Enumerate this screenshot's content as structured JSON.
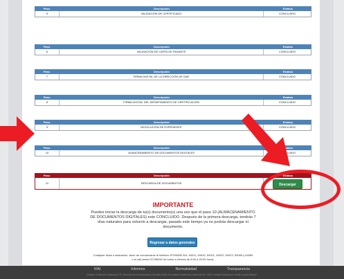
{
  "table_header": {
    "paso": "Paso",
    "descripcion": "Descripción",
    "estatus": "Estatus"
  },
  "steps": [
    {
      "paso": "5",
      "descripcion": "VALIDACIÓN DE CERTIFICADO",
      "estatus": "CONCLUIDO"
    },
    {
      "paso": "6",
      "descripcion": "VALIDACIÓN DE CARTA DE PASANTE",
      "estatus": "CONCLUIDO"
    },
    {
      "paso": "7",
      "descripcion": "FIRMA DIGITAL DE LA DIRECCIÓN DE DAE",
      "estatus": "CONCLUIDO"
    },
    {
      "paso": "8",
      "descripcion": "FIRMA DIGITAL DEL DEPARTAMENTO DE CERTIFICACIÓN",
      "estatus": "CONCLUIDO"
    },
    {
      "paso": "9",
      "descripcion": "DEVOLUCIÓN DE EXPEDIENTE",
      "estatus": "CONCLUIDO"
    },
    {
      "paso": "10",
      "descripcion": "ALMACENAMIENTO DE DOCUMENTOS DIGITALES",
      "estatus": "CONCLUIDO"
    },
    {
      "paso": "11",
      "descripcion": "DESCARGA DE DOCUMENTOS",
      "estatus": ""
    }
  ],
  "download_button": "Descargar",
  "important": {
    "title": "IMPORTANTE",
    "body": "Puedes iniciar la descarga de tu(s) documento(s) una vez que el paso 10 (ALMACENAMIENTO DE DOCUMENTOS DIGITALES) este CONCLUIDO. Después de la primera descarga, tendrás 7 días naturales para volverlo a descargar, pasado este tiempo ya no podrás descargar el documento."
  },
  "back_button": "Regresar a datos generales",
  "contact": {
    "line1": "Cualquier duda o aclaración, favor de comunicarse al teléfono 57296000 Ext. 54011, 54020, 54021, 54022, 54023, 54065 y 54069",
    "line2": "o al call center 57296262 de lunes a viernes de 8:00 a 20:00 horas."
  },
  "footer": {
    "links": [
      "IFAI",
      "Informes",
      "Normatividad",
      "Transparencia"
    ],
    "fine_print": "Instituto Politécnico Nacional D.R. Dirección de Administración Escolar (DAE) del Instituto Politécnico Nacional No. 1936, Unidad Profesional \"Adolfo López Mateos\""
  },
  "colors": {
    "header_blue": "#4e83b8",
    "header_red": "#a0141d",
    "annotation_red": "#ec1c24",
    "download_green": "#2e8b4a"
  }
}
